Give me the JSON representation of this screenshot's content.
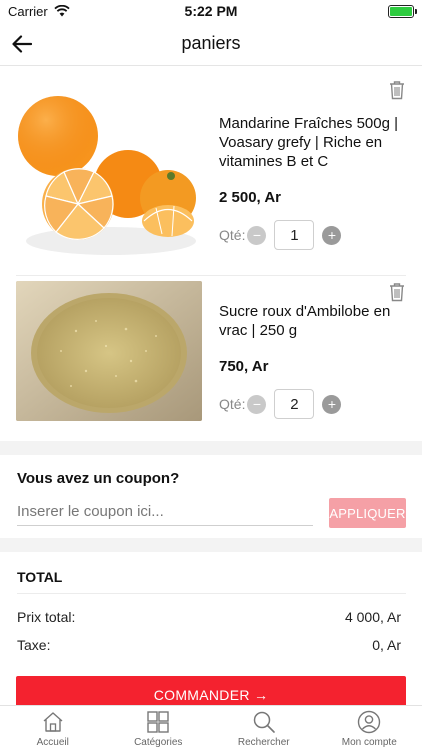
{
  "status_bar": {
    "carrier": "Carrier",
    "time": "5:22 PM",
    "battery_level": 1.0
  },
  "header": {
    "title": "paniers"
  },
  "cart": {
    "quantity_label": "Qté:",
    "items": [
      {
        "name": "Mandarine Fraîches 500g | Voasary grefy | Riche en vitamines B et C",
        "price": "2 500, Ar",
        "quantity": "1",
        "image_icon": "mandarin-oranges-photo"
      },
      {
        "name": "Sucre roux d'Ambilobe en vrac | 250 g",
        "price": "750, Ar",
        "quantity": "2",
        "image_icon": "brown-sugar-photo"
      }
    ]
  },
  "coupon": {
    "title": "Vous avez un coupon?",
    "placeholder": "Inserer le coupon ici...",
    "apply_label": "APPLIQUER"
  },
  "totals": {
    "title": "TOTAL",
    "rows": [
      {
        "label": "Prix total:",
        "value": "4 000, Ar"
      },
      {
        "label": "Taxe:",
        "value": "0, Ar"
      }
    ]
  },
  "order_button": {
    "label": "COMMANDER →"
  },
  "tabs": [
    {
      "label": "Accueil",
      "icon": "home-icon"
    },
    {
      "label": "Catégories",
      "icon": "grid-icon"
    },
    {
      "label": "Rechercher",
      "icon": "search-icon"
    },
    {
      "label": "Mon compte",
      "icon": "user-icon"
    }
  ],
  "colors": {
    "accent": "#f4222f",
    "apply_button": "#f5a0a6",
    "battery": "#2ecc40"
  }
}
